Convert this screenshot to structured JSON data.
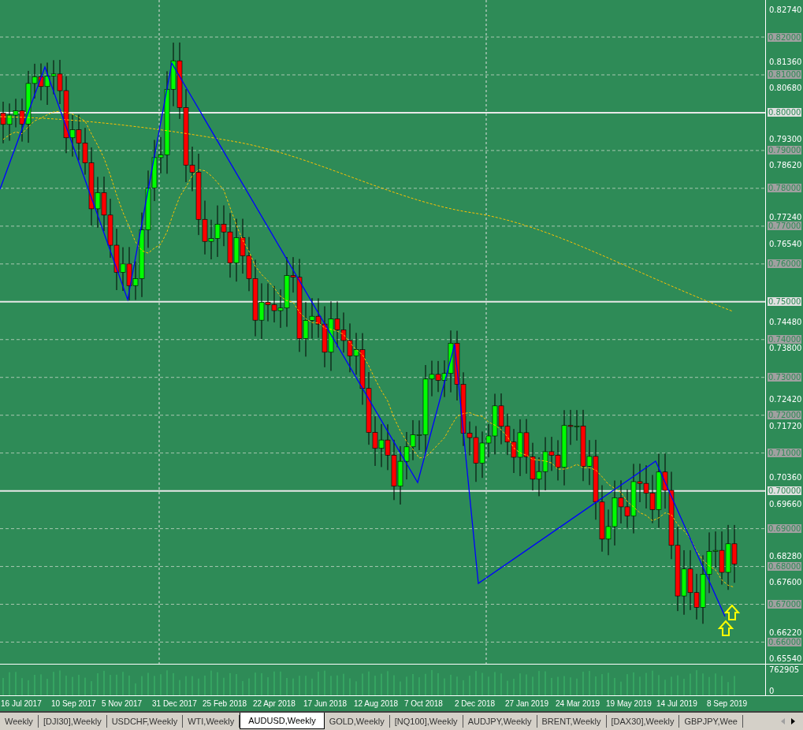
{
  "price_axis": {
    "labels": [
      "0.82740",
      "0.81360",
      "0.80680",
      "0.79300",
      "0.78620",
      "0.77240",
      "0.76540",
      "0.74480",
      "0.73800",
      "0.72420",
      "0.71720",
      "0.70360",
      "0.69660",
      "0.68280",
      "0.67600",
      "0.66220",
      "0.65540"
    ],
    "level_labels": [
      {
        "text": "0.82000",
        "kind": "minor"
      },
      {
        "text": "0.81000",
        "kind": "minor"
      },
      {
        "text": "0.80000",
        "kind": "major"
      },
      {
        "text": "0.79000",
        "kind": "minor"
      },
      {
        "text": "0.78000",
        "kind": "minor"
      },
      {
        "text": "0.77000",
        "kind": "minor"
      },
      {
        "text": "0.76000",
        "kind": "minor"
      },
      {
        "text": "0.75000",
        "kind": "major"
      },
      {
        "text": "0.74000",
        "kind": "minor"
      },
      {
        "text": "0.73000",
        "kind": "minor"
      },
      {
        "text": "0.72000",
        "kind": "minor"
      },
      {
        "text": "0.71000",
        "kind": "minor"
      },
      {
        "text": "0.70000",
        "kind": "major"
      },
      {
        "text": "0.69000",
        "kind": "minor"
      },
      {
        "text": "0.68000",
        "kind": "minor"
      },
      {
        "text": "0.67000",
        "kind": "minor"
      },
      {
        "text": "0.66000",
        "kind": "minor"
      }
    ]
  },
  "volume_axis": {
    "labels": [
      "762905",
      "0"
    ]
  },
  "time_axis": {
    "labels": [
      "16 Jul 2017",
      "10 Sep 2017",
      "5 Nov 2017",
      "31 Dec 2017",
      "25 Feb 2018",
      "22 Apr 2018",
      "17 Jun 2018",
      "12 Aug 2018",
      "7 Oct 2018",
      "2 Dec 2018",
      "27 Jan 2019",
      "24 Mar 2019",
      "19 May 2019",
      "14 Jul 2019",
      "8 Sep 2019"
    ]
  },
  "tabs": [
    {
      "label": "Weekly",
      "selected": false
    },
    {
      "label": "[DJI30],Weekly",
      "selected": false
    },
    {
      "label": "USDCHF,Weekly",
      "selected": false
    },
    {
      "label": "WTI,Weekly",
      "selected": false
    },
    {
      "label": "AUDUSD,Weekly",
      "selected": true
    },
    {
      "label": "GOLD,Weekly",
      "selected": false
    },
    {
      "label": "[NQ100],Weekly",
      "selected": false
    },
    {
      "label": "AUDJPY,Weekly",
      "selected": false
    },
    {
      "label": "BRENT,Weekly",
      "selected": false
    },
    {
      "label": "[DAX30],Weekly",
      "selected": false
    },
    {
      "label": "GBPJPY,Wee",
      "selected": false
    }
  ]
}
